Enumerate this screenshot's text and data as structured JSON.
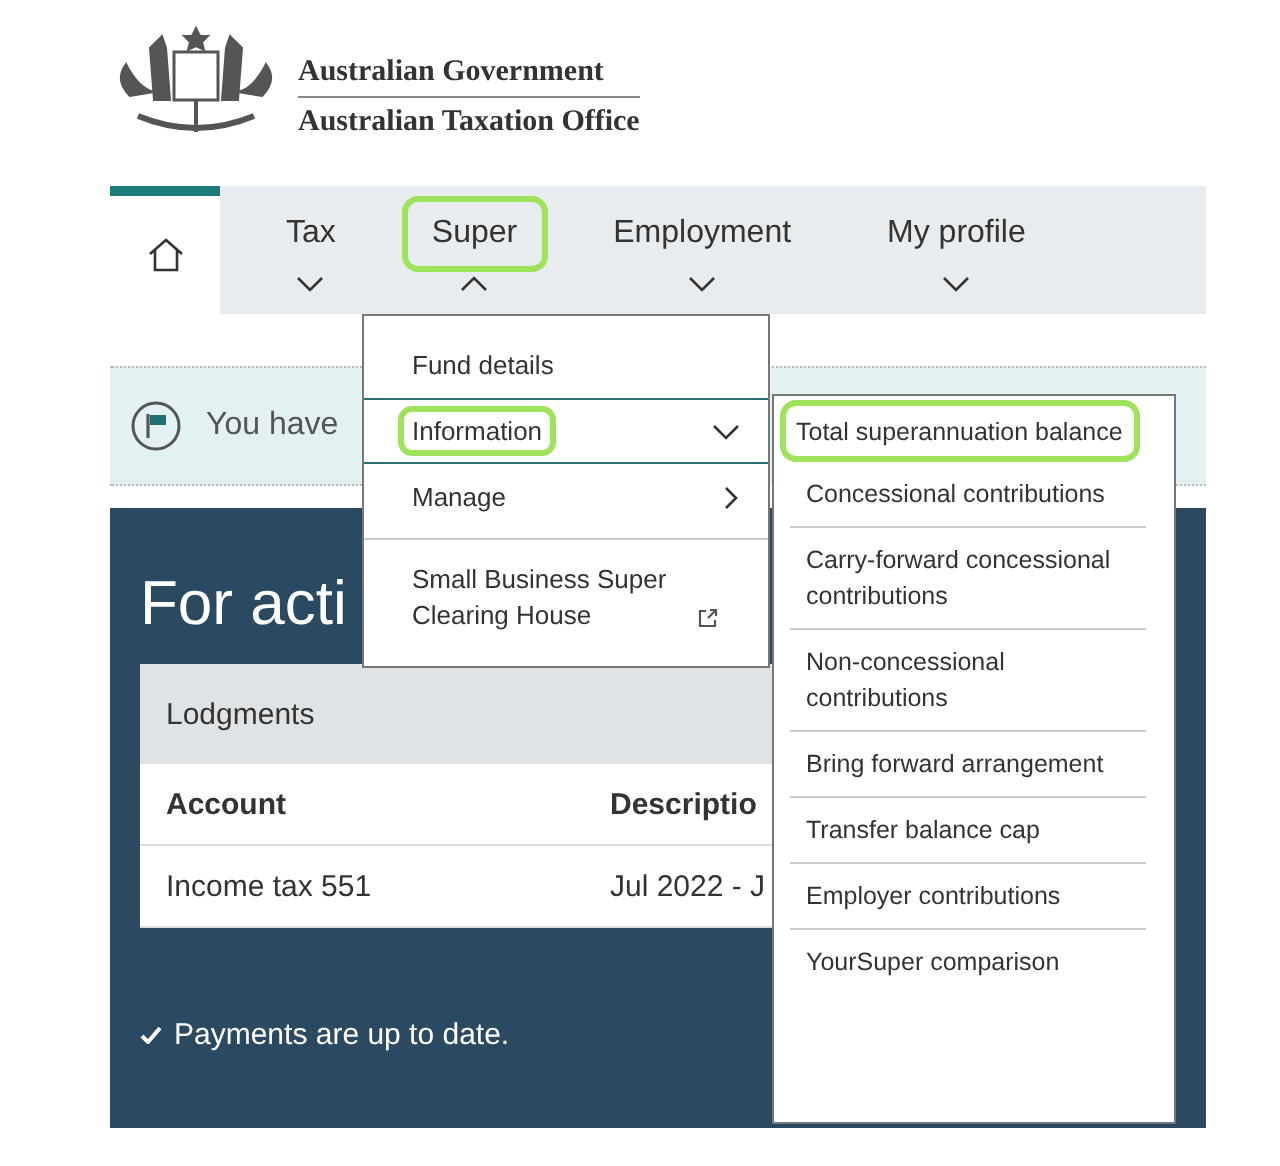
{
  "header": {
    "government": "Australian Government",
    "agency": "Australian Taxation Office"
  },
  "nav": {
    "tabs": [
      {
        "kind": "home",
        "selected": true
      },
      {
        "kind": "menu",
        "label": "Tax",
        "selected": false,
        "highlighted": false,
        "expanded": false
      },
      {
        "kind": "menu",
        "label": "Super",
        "selected": false,
        "highlighted": true,
        "expanded": true
      },
      {
        "kind": "menu",
        "label": "Employment",
        "selected": false,
        "highlighted": false,
        "expanded": false
      },
      {
        "kind": "menu",
        "label": "My profile",
        "selected": false,
        "highlighted": false,
        "expanded": false
      }
    ]
  },
  "alert": {
    "text": "You have"
  },
  "panel": {
    "heading": "For acti",
    "card": {
      "title": "Lodgments",
      "columns": [
        "Account",
        "Descriptio"
      ],
      "rows": [
        [
          "Income tax 551",
          "Jul 2022 - J"
        ]
      ]
    },
    "status": "Payments are up to date."
  },
  "super_menu": {
    "items": [
      {
        "label": "Fund details",
        "kind": "plain",
        "selected": false,
        "highlighted": false
      },
      {
        "label": "Information",
        "kind": "expand",
        "selected": true,
        "highlighted": true
      },
      {
        "label": "Manage",
        "kind": "submenu",
        "selected": false,
        "highlighted": false
      },
      {
        "label": "Small Business Super Clearing House",
        "kind": "external",
        "selected": false,
        "highlighted": false
      }
    ]
  },
  "information_menu": {
    "items": [
      {
        "label": "Total superannuation balance",
        "highlighted": true
      },
      {
        "label": "Concessional contributions",
        "highlighted": false
      },
      {
        "label": "Carry-forward concessional contributions",
        "highlighted": false
      },
      {
        "label": "Non-concessional contributions",
        "highlighted": false
      },
      {
        "label": "Bring forward arrangement",
        "highlighted": false
      },
      {
        "label": "Transfer balance cap",
        "highlighted": false
      },
      {
        "label": "Employer contributions",
        "highlighted": false
      },
      {
        "label": "YourSuper comparison",
        "highlighted": false
      }
    ]
  }
}
